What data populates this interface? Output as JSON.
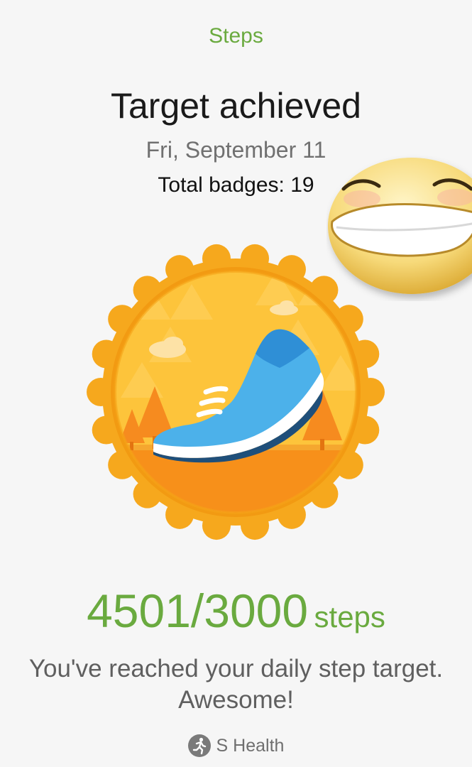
{
  "header": {
    "title": "Steps"
  },
  "achievement": {
    "title": "Target achieved",
    "date": "Fri, September 11",
    "badges_label": "Total badges: 19"
  },
  "badge": {
    "icon": "running-shoe-badge-icon"
  },
  "overlay": {
    "icon": "grinning-face-emoji"
  },
  "progress": {
    "count": "4501/3000",
    "unit": "steps",
    "message": "You've reached your daily step target. Awesome!"
  },
  "footer": {
    "app_name": "S Health",
    "icon": "running-person-icon"
  },
  "colors": {
    "accent_green": "#6aaa3f",
    "badge_orange": "#f4a21f",
    "badge_yellow": "#fcc43a",
    "shoe_blue": "#2f8fd6"
  }
}
